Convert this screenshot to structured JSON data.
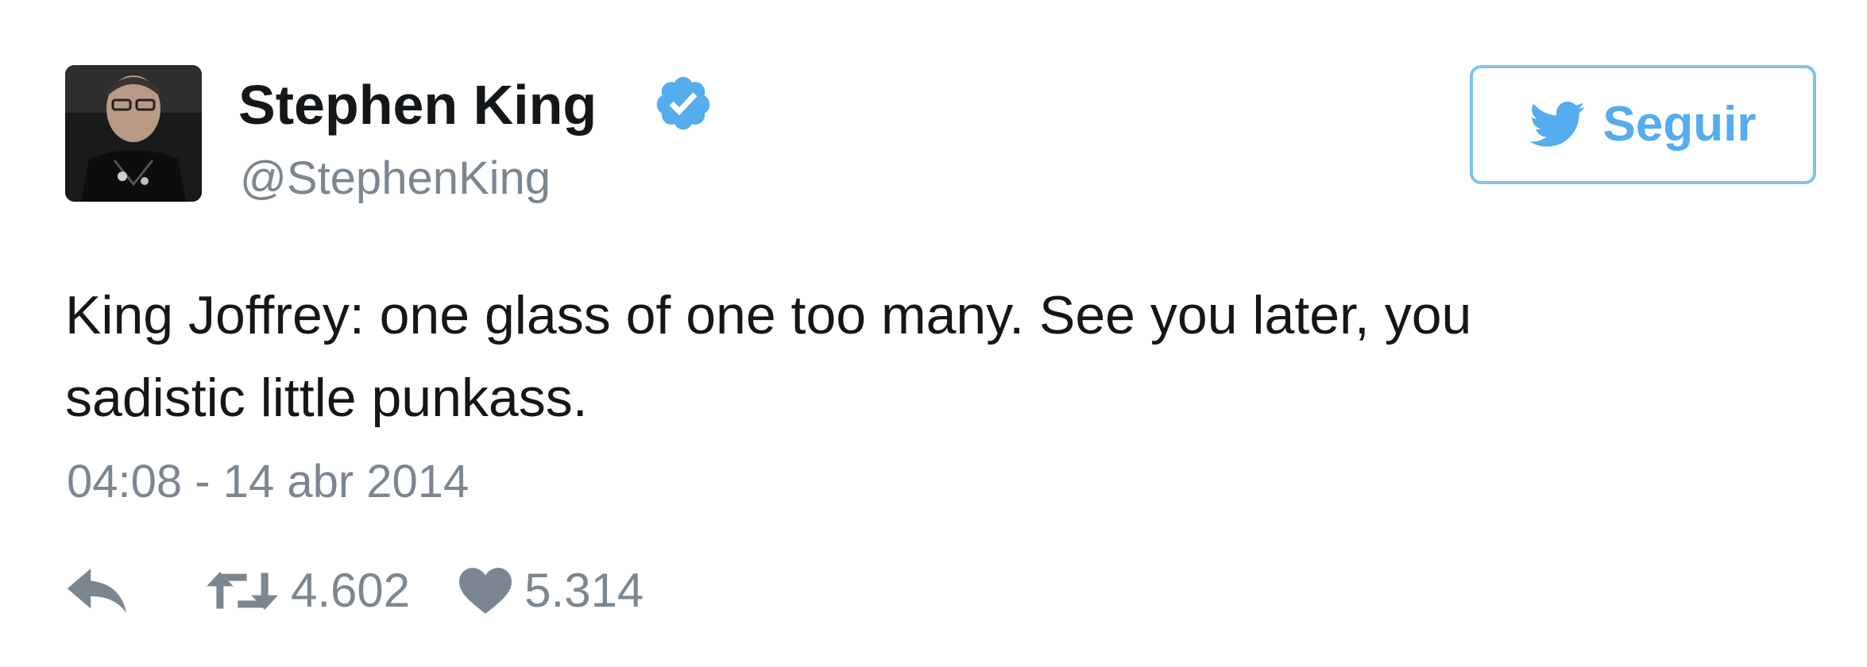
{
  "user": {
    "display_name": "Stephen King",
    "handle": "@StephenKing",
    "verified_icon": "verified-badge-icon"
  },
  "follow_button": {
    "label": "Seguir",
    "icon": "twitter-bird-icon"
  },
  "tweet": {
    "text": "King Joffrey: one glass of one too many. See you later, you\nsadistic little punkass.",
    "timestamp": "04:08 - 14 abr 2014"
  },
  "actions": {
    "reply_icon": "reply-icon",
    "retweet_icon": "retweet-icon",
    "retweet_count": "4.602",
    "like_icon": "heart-icon",
    "like_count": "5.314"
  },
  "colors": {
    "accent": "#55acee",
    "text": "#14171a",
    "secondary_text": "#7c8690",
    "button_border": "#7fc1f0"
  }
}
